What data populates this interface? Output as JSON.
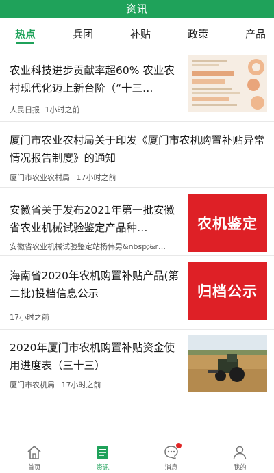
{
  "header": {
    "title": "资讯"
  },
  "tabs": [
    {
      "label": "热点",
      "active": true
    },
    {
      "label": "兵团"
    },
    {
      "label": "补贴"
    },
    {
      "label": "政策"
    },
    {
      "label": "产品"
    }
  ],
  "news": [
    {
      "title": "农业科技进步贡献率超60% 农业农村现代化迈上新台阶（“十三…",
      "source": "人民日报",
      "time": "1小时之前",
      "thumb": "infographic-chart-image"
    },
    {
      "title": "厦门市农业农村局关于印发《厦门市农机购置补贴异常情况报告制度》的通知",
      "source": "厦门市农业农村局",
      "time": "17小时之前"
    },
    {
      "title": "安徽省关于发布2021年第一批安徽省农业机械试验鉴定产品种…",
      "source": "安徽省农业机械试验鉴定站杨伟男&nbsp;&r…",
      "thumb": "red-banner-image",
      "thumb_text": "农机鉴定"
    },
    {
      "title": "海南省2020年农机购置补贴产品(第二批)投档信息公示",
      "time": "17小时之前",
      "thumb": "red-banner-image",
      "thumb_text": "归档公示"
    },
    {
      "title": "2020年厦门市农机购置补贴资金使用进度表（三十三）",
      "source": "厦门市农机局",
      "time": "17小时之前",
      "thumb": "tractor-field-photo"
    }
  ],
  "bottom_nav": [
    {
      "label": "首页",
      "icon": "home-icon"
    },
    {
      "label": "资讯",
      "icon": "news-icon",
      "active": true
    },
    {
      "label": "消息",
      "icon": "message-icon",
      "badge": true
    },
    {
      "label": "我的",
      "icon": "user-icon"
    }
  ],
  "colors": {
    "brand_green": "#1fa25a",
    "banner_red": "#de2026",
    "badge_red": "#e02727"
  }
}
